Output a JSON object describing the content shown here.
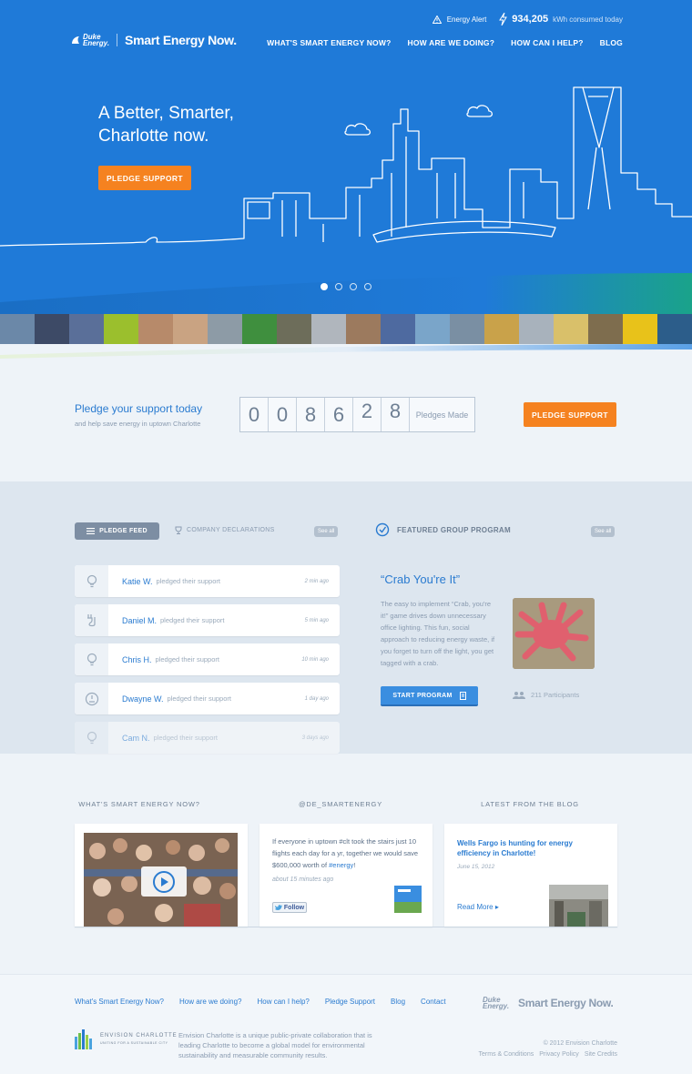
{
  "topbar": {
    "alert_label": "Energy Alert",
    "kwh_value": "934,205",
    "kwh_label": "kWh consumed today"
  },
  "brand": {
    "duke_line1": "Duke",
    "duke_line2": "Energy.",
    "name": "Smart Energy Now."
  },
  "nav": {
    "items": [
      "WHAT'S SMART ENERGY NOW?",
      "HOW ARE WE DOING?",
      "HOW CAN I HELP?",
      "BLOG"
    ]
  },
  "hero": {
    "title_line1": "A Better, Smarter,",
    "title_line2": "Charlotte now.",
    "button": "PLEDGE SUPPORT",
    "slides": 4,
    "active_slide": 1
  },
  "pledge": {
    "title": "Pledge your support today",
    "subtitle": "and help save energy in uptown Charlotte",
    "digits": [
      "0",
      "0",
      "8",
      "6",
      "2",
      "8"
    ],
    "counter_label": "Pledges Made",
    "button": "PLEDGE SUPPORT"
  },
  "feed": {
    "tab_active": "PLEDGE FEED",
    "tab_other": "COMPANY DECLARATIONS",
    "see_all": "See all",
    "items": [
      {
        "name": "Katie W.",
        "action": "pledged their support",
        "time": "2 min ago",
        "icon": "lightbulb-icon"
      },
      {
        "name": "Daniel M.",
        "action": "pledged their support",
        "time": "5 min ago",
        "icon": "plug-icon"
      },
      {
        "name": "Chris H.",
        "action": "pledged their support",
        "time": "10 min ago",
        "icon": "lightbulb-icon"
      },
      {
        "name": "Dwayne W.",
        "action": "pledged their support",
        "time": "1 day ago",
        "icon": "thermostat-icon"
      },
      {
        "name": "Cam N.",
        "action": "pledged their support",
        "time": "3 days ago",
        "icon": "lightbulb-icon"
      }
    ]
  },
  "group_program": {
    "heading": "FEATURED GROUP PROGRAM",
    "see_all": "See all",
    "title": "“Crab You're It”",
    "description": "The easy to implement “Crab, you're it!” game drives down unnecessary office lighting. This fun, social approach to reducing energy waste, if you forget to turn off the light, you get tagged with a crab.",
    "button": "START PROGRAM",
    "participants": "211 Participants"
  },
  "lower": {
    "video_heading": "WHAT'S SMART ENERGY NOW?",
    "twitter_heading": "@DE_SMARTENERGY",
    "blog_heading": "LATEST FROM THE BLOG",
    "tweet_text": "If everyone in uptown #clt took the stairs just 10 flights each day for a yr, together we would save $600,000 worth of ",
    "tweet_tag": "#energy",
    "tweet_end": "!",
    "tweet_time": "about 15 minutes ago",
    "follow_label": "Follow",
    "blog_title": "Wells Fargo is hunting for energy efficiency in Charlotte!",
    "blog_date": "June 15, 2012",
    "blog_more": "Read More"
  },
  "footer": {
    "links": [
      "What's Smart Energy Now?",
      "How are we doing?",
      "How can I help?",
      "Pledge Support",
      "Blog",
      "Contact"
    ],
    "duke_line1": "Duke",
    "duke_line2": "Energy.",
    "brand": "Smart Energy Now.",
    "env_name": "ENVISION CHARLOTTE",
    "env_tagline": "UNITING FOR A SUSTAINABLE CITY",
    "env_desc": "Envision Charlotte is a unique public-private collaboration that is leading Charlotte to become a global model for environmental sustainability and measurable community results.",
    "copyright": "© 2012 Envision Charlotte",
    "legal": [
      "Terms & Conditions",
      "Privacy Policy",
      "Site Credits"
    ]
  },
  "colors": {
    "hero_blue": "#1f7ad8",
    "accent_orange": "#f58220",
    "link_blue": "#2a7bd0"
  }
}
